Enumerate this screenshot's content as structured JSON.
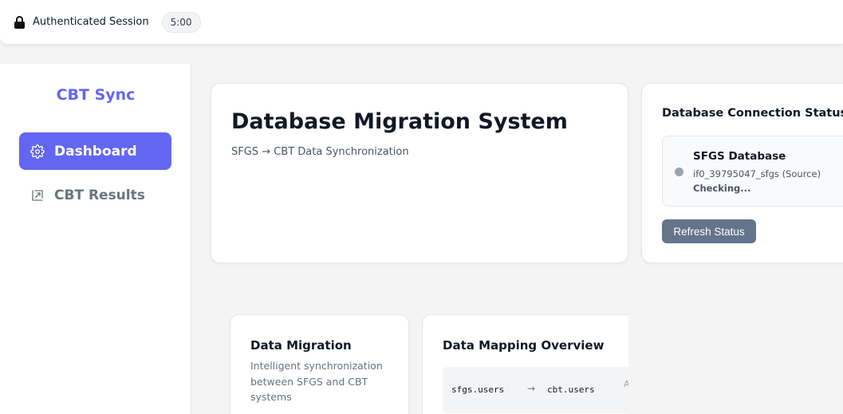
{
  "session": {
    "label": "Authenticated Session",
    "timer": "5:00"
  },
  "sidebar": {
    "brand": "CBT Sync",
    "items": [
      {
        "label": "Dashboard",
        "icon": "gear-icon",
        "active": true
      },
      {
        "label": "CBT Results",
        "icon": "external-chart-icon",
        "active": false
      }
    ]
  },
  "hero": {
    "title": "Database Migration System",
    "subtitle": "SFGS → CBT Data Synchronization"
  },
  "connection": {
    "title": "Database Connection Status",
    "database": {
      "name": "SFGS Database",
      "id": "if0_39795047_sfgs (Source)",
      "state": "Checking..."
    },
    "refresh_label": "Refresh Status"
  },
  "migration": {
    "title": "Data Migration",
    "description": "Intelligent synchronization between SFGS and CBT systems"
  },
  "mapping": {
    "title": "Data Mapping Overview",
    "rows": [
      {
        "source": "sfgs.users",
        "arrow": "→",
        "target": "cbt.users",
        "note": "A a"
      }
    ]
  },
  "colors": {
    "accent": "#6366f1",
    "button": "#64748b",
    "status_unknown": "#9ca3af"
  }
}
